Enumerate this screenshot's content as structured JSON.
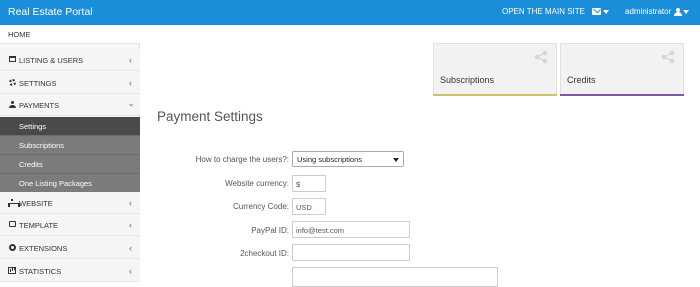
{
  "topbar": {
    "brand": "Real Estate Portal",
    "site_link": "OPEN THE MAIN SITE",
    "user": "administrator",
    "mail_icon": "envelope-icon",
    "user_icon": "user-icon",
    "color": "#1a8ed9"
  },
  "sidebar": {
    "home": "HOME",
    "items": [
      {
        "label": "LISTING & USERS",
        "icon": "grid-icon"
      },
      {
        "label": "SETTINGS",
        "icon": "cogs-icon"
      },
      {
        "label": "PAYMENTS",
        "icon": "user-icon"
      },
      {
        "label": "WEBSITE",
        "icon": "sitemap-icon"
      },
      {
        "label": "TEMPLATE",
        "icon": "square-icon"
      },
      {
        "label": "EXTENSIONS",
        "icon": "circle-icon"
      },
      {
        "label": "STATISTICS",
        "icon": "chart-icon"
      }
    ],
    "payments_sub": [
      {
        "label": "Settings",
        "active": true
      },
      {
        "label": "Subscriptions"
      },
      {
        "label": "Credits"
      },
      {
        "label": "One Listing Packages"
      }
    ]
  },
  "cards": [
    {
      "title": "Subscriptions",
      "accent": "#c9c36a",
      "icon": "share-icon"
    },
    {
      "title": "Credits",
      "accent": "#7a5aa8",
      "icon": "share-icon"
    }
  ],
  "page": {
    "title": "Payment Settings"
  },
  "form": {
    "charge_label": "How to charge the users?:",
    "charge_value": "Using subscriptions",
    "currency_label": "Website currency:",
    "currency_value": "$",
    "code_label": "Currency Code:",
    "code_value": "USD",
    "paypal_label": "PayPal ID:",
    "paypal_value": "info@test.com",
    "checkout_label": "2checkout ID:",
    "checkout_value": ""
  }
}
